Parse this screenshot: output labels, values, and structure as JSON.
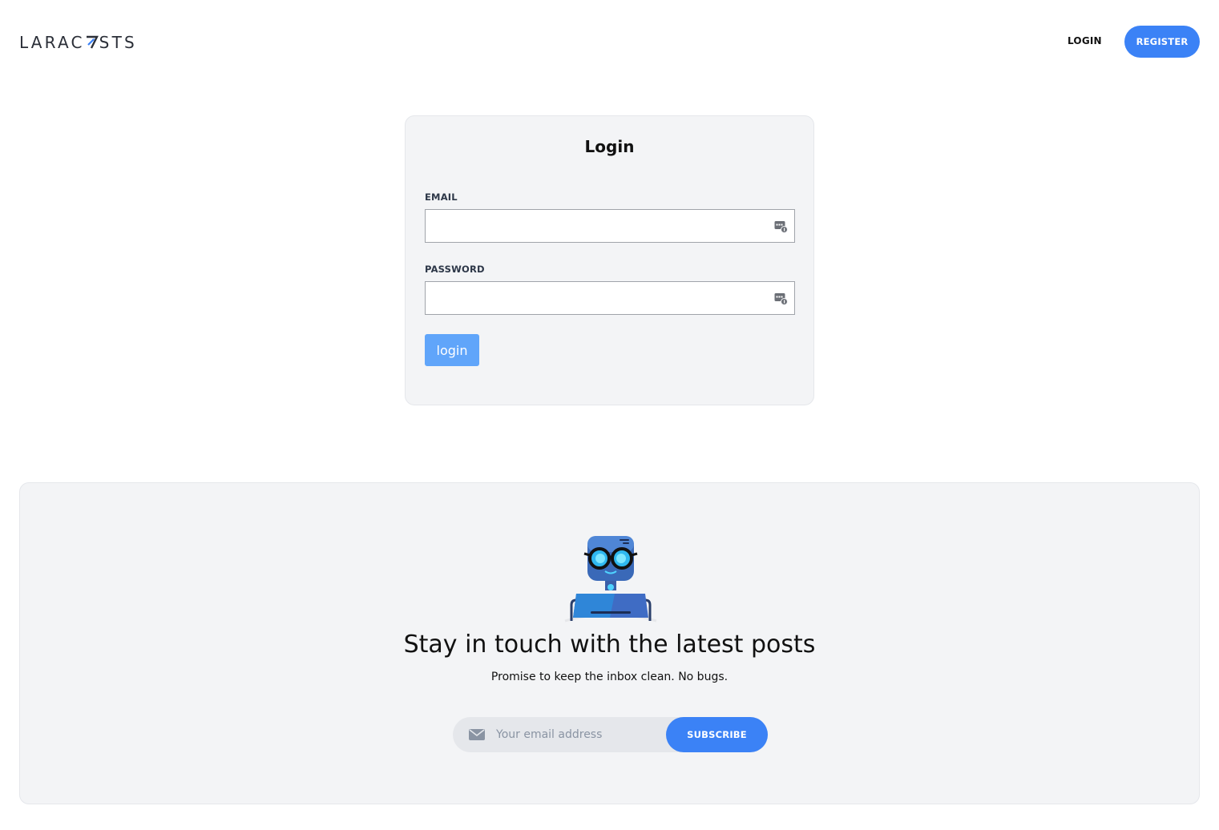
{
  "header": {
    "logo_text": "LARACASTS",
    "nav": {
      "login_label": "LOGIN",
      "register_label": "REGISTER"
    }
  },
  "login_card": {
    "title": "Login",
    "email": {
      "label": "EMAIL",
      "value": "",
      "placeholder": ""
    },
    "password": {
      "label": "PASSWORD",
      "value": "",
      "placeholder": ""
    },
    "submit_label": "login"
  },
  "newsletter": {
    "title": "Stay in touch with the latest posts",
    "subtitle": "Promise to keep the inbox clean. No bugs.",
    "email_placeholder": "Your email address",
    "subscribe_label": "SUBSCRIBE",
    "mail_icon": "envelope-icon",
    "illustration": "robot-with-glasses-illustration"
  },
  "colors": {
    "primary": "#3b82f6",
    "primary_light": "#60a5fa",
    "panel_bg": "#f3f4f6",
    "text": "#111111"
  }
}
